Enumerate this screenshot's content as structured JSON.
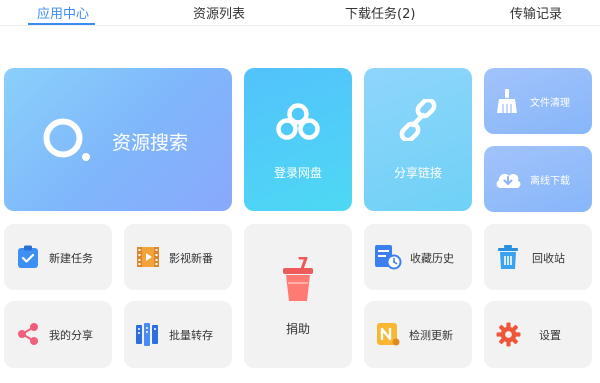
{
  "nav": {
    "tabs": [
      {
        "label": "应用中心"
      },
      {
        "label": "资源列表"
      },
      {
        "label": "下载任务(2)"
      },
      {
        "label": "传输记录"
      }
    ],
    "active_color": "#3b8cf6"
  },
  "tiles": {
    "search": {
      "label": "资源搜索",
      "icon": "search-icon"
    },
    "login": {
      "label": "登录网盘",
      "icon": "cloud-icon"
    },
    "share_link": {
      "label": "分享链接",
      "icon": "link-icon"
    },
    "file_clean": {
      "label": "文件清理",
      "icon": "broom-icon"
    },
    "offline": {
      "label": "离线下载",
      "icon": "cloud-download-icon"
    },
    "new_task": {
      "label": "新建任务",
      "icon": "clipboard-check-icon"
    },
    "video": {
      "label": "影视新番",
      "icon": "film-icon"
    },
    "donate": {
      "label": "捐助",
      "icon": "drink-cup-icon"
    },
    "history": {
      "label": "收藏历史",
      "icon": "history-icon"
    },
    "recycle": {
      "label": "回收站",
      "icon": "trash-icon"
    },
    "my_share": {
      "label": "我的分享",
      "icon": "share-icon"
    },
    "batch": {
      "label": "批量转存",
      "icon": "batch-icon"
    },
    "update": {
      "label": "检测更新",
      "icon": "update-icon"
    },
    "settings": {
      "label": "设置",
      "icon": "gear-icon"
    }
  }
}
